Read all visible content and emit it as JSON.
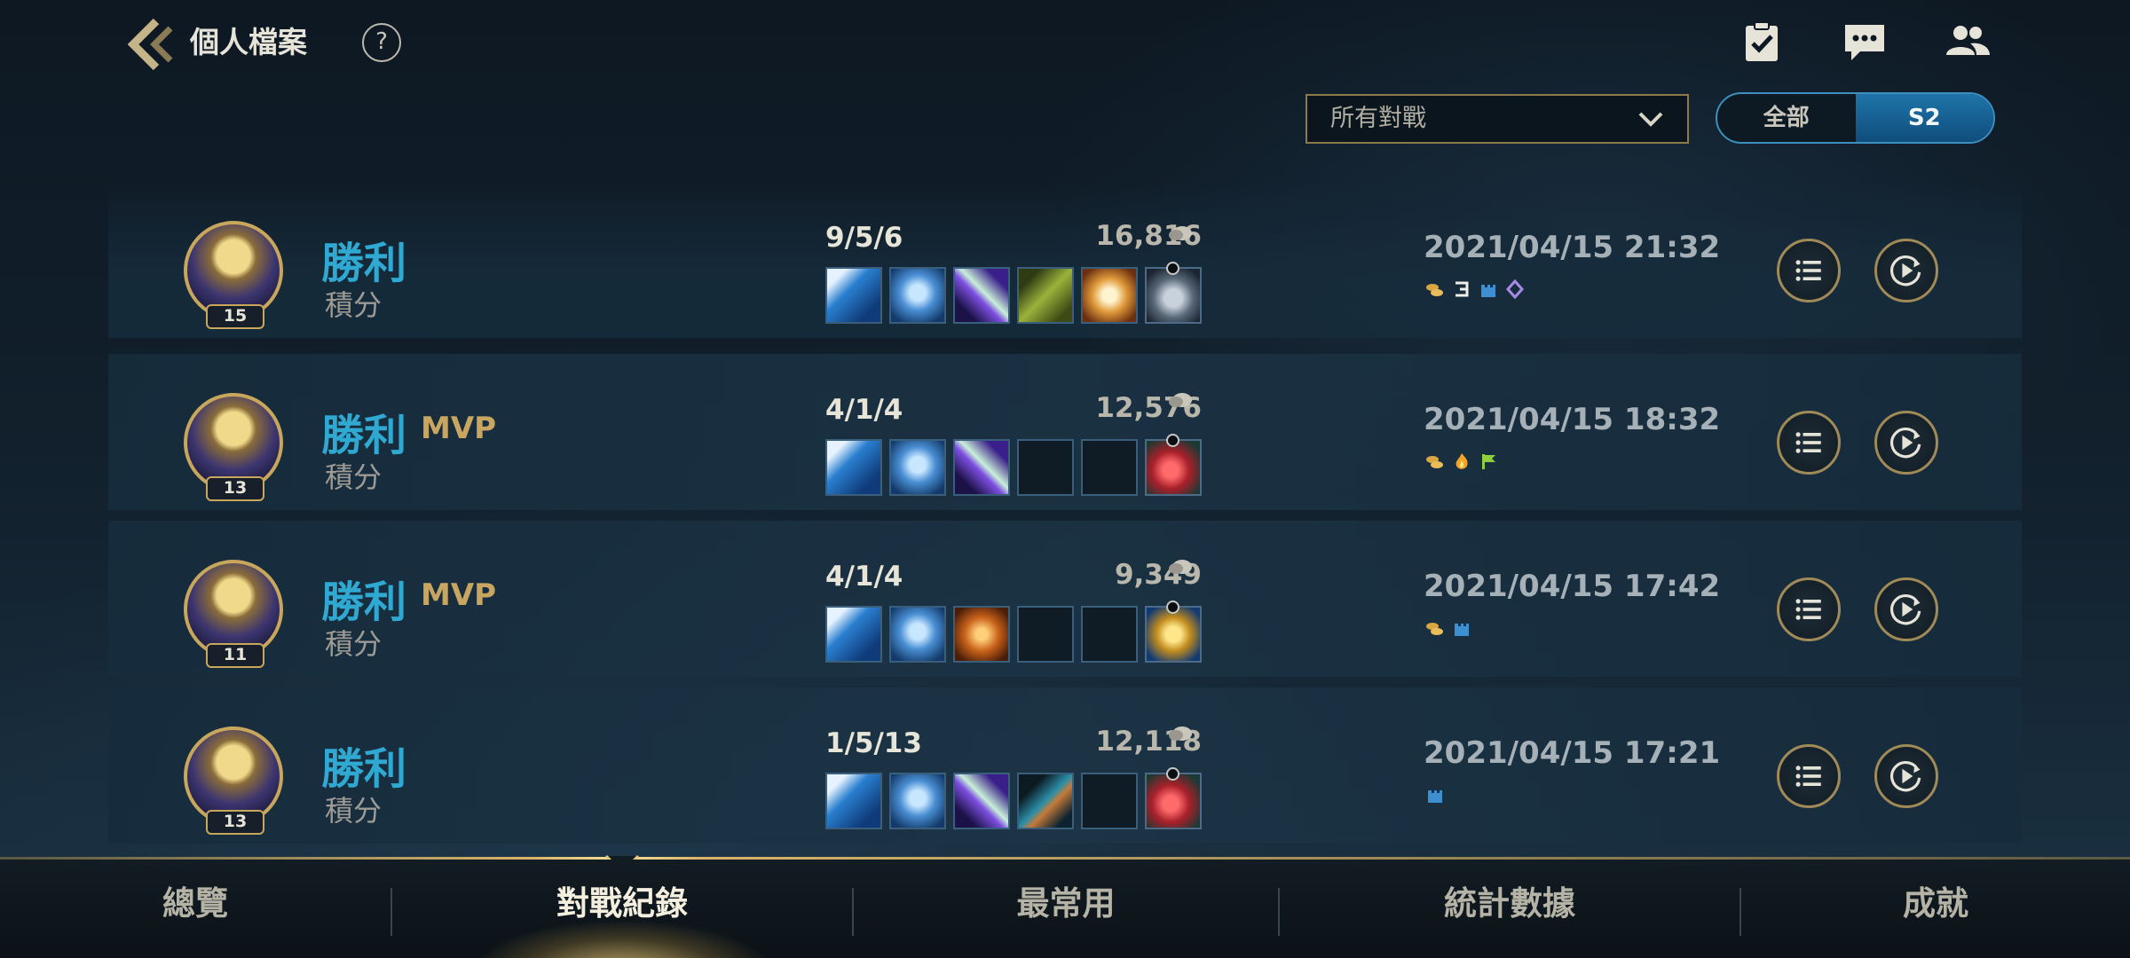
{
  "header": {
    "title": "個人檔案",
    "help": "?"
  },
  "filter": {
    "selected": "所有對戰"
  },
  "season_toggle": {
    "options": [
      "全部",
      "S2"
    ],
    "active": "S2"
  },
  "matches": [
    {
      "level": "15",
      "result": "勝利",
      "mvp": "",
      "mode": "積分",
      "kda": "9/5/6",
      "gold": "16,816",
      "items": [
        "lance-item",
        "frost-gauntlet-item",
        "purple-blade-item",
        "green-crossbow-item",
        "golden-wings-item"
      ],
      "trinket": "grey-beast-trinket",
      "datetime": "2021/04/15 21:32",
      "objectives": [
        "gold-coins-icon",
        "triple-kill-icon",
        "tower-icon",
        "purple-gem-icon"
      ]
    },
    {
      "level": "13",
      "result": "勝利",
      "mvp": "MVP",
      "mode": "積分",
      "kda": "4/1/4",
      "gold": "12,576",
      "items": [
        "lance-item",
        "frost-gauntlet-item",
        "purple-blade-item",
        "",
        ""
      ],
      "trinket": "red-boot-trinket",
      "datetime": "2021/04/15 18:32",
      "objectives": [
        "gold-coins-icon",
        "fire-icon",
        "flag-icon"
      ]
    },
    {
      "level": "11",
      "result": "勝利",
      "mvp": "MVP",
      "mode": "積分",
      "kda": "4/1/4",
      "gold": "9,349",
      "items": [
        "lance-item",
        "frost-gauntlet-item",
        "orange-claw-item",
        "",
        ""
      ],
      "trinket": "golden-hourglass-trinket",
      "datetime": "2021/04/15 17:42",
      "objectives": [
        "gold-coins-icon",
        "tower-icon"
      ]
    },
    {
      "level": "13",
      "result": "勝利",
      "mvp": "",
      "mode": "積分",
      "kda": "1/5/13",
      "gold": "12,118",
      "items": [
        "lance-item",
        "frost-gauntlet-item",
        "purple-blade-item",
        "teal-arrow-item",
        ""
      ],
      "trinket": "red-boot-trinket",
      "datetime": "2021/04/15 17:21",
      "objectives": [
        "tower-icon"
      ]
    }
  ],
  "tabs": [
    "總覽",
    "對戰紀錄",
    "最常用",
    "統計數據",
    "成就"
  ],
  "active_tab": "對戰紀錄",
  "colors": {
    "victory": "#2fa9d2",
    "mvp": "#c8a660",
    "accent_gold": "#c8a75d",
    "toggle_active": "#1f74a9"
  }
}
